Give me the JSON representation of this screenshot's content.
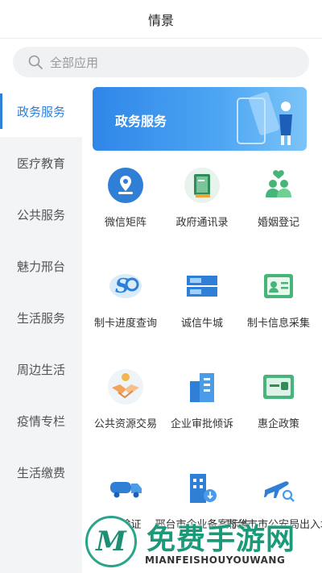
{
  "header": {
    "title": "情景"
  },
  "search": {
    "placeholder": "全部应用"
  },
  "sidebar": {
    "items": [
      {
        "label": "政务服务",
        "active": true
      },
      {
        "label": "医疗教育"
      },
      {
        "label": "公共服务"
      },
      {
        "label": "魅力邢台"
      },
      {
        "label": "生活服务"
      },
      {
        "label": "周边生活"
      },
      {
        "label": "疫情专栏"
      },
      {
        "label": "生活缴费"
      }
    ]
  },
  "banner": {
    "title": "政务服务"
  },
  "apps": [
    {
      "label": "微信矩阵",
      "icon": "location-pin-icon"
    },
    {
      "label": "政府通讯录",
      "icon": "address-book-icon"
    },
    {
      "label": "婚姻登记",
      "icon": "couple-heart-icon"
    },
    {
      "label": "制卡进度查询",
      "icon": "progress-card-icon"
    },
    {
      "label": "诚信牛城",
      "icon": "credit-card-icon"
    },
    {
      "label": "制卡信息采集",
      "icon": "id-card-icon"
    },
    {
      "label": "公共资源交易",
      "icon": "handshake-coin-icon"
    },
    {
      "label": "企业审批倾诉",
      "icon": "buildings-icon"
    },
    {
      "label": "惠企政策",
      "icon": "policy-board-icon"
    },
    {
      "label": "运输证",
      "icon": "truck-icon"
    },
    {
      "label": "邢台市企业备案标准",
      "icon": "building-download-icon"
    },
    {
      "label": "邢台市市公安局出入境",
      "icon": "airplane-search-icon"
    }
  ],
  "watermark": {
    "cn": "免费手游网",
    "en": "MIANFEISHOUYOUWANG",
    "logo_letter": "M"
  },
  "colors": {
    "accent": "#2e7fd9",
    "watermark_green": "#1b9a7a"
  }
}
